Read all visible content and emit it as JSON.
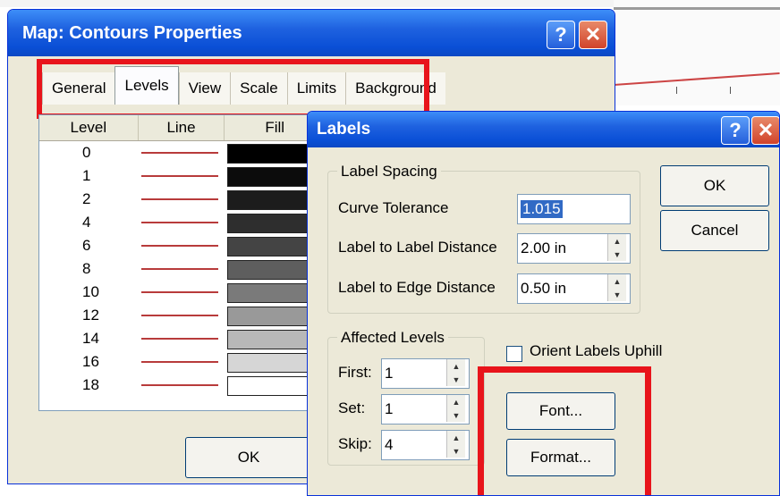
{
  "main_dialog": {
    "title": "Map: Contours Properties",
    "help_glyph": "?",
    "close_glyph": "✕",
    "tabs": [
      "General",
      "Levels",
      "View",
      "Scale",
      "Limits",
      "Background"
    ],
    "active_tab": "Levels",
    "table": {
      "headers": [
        "Level",
        "Line",
        "Fill"
      ],
      "rows": [
        {
          "level": "0",
          "fill": "#000000"
        },
        {
          "level": "1",
          "fill": "#0c0c0c"
        },
        {
          "level": "2",
          "fill": "#1c1c1c"
        },
        {
          "level": "4",
          "fill": "#2e2e2e"
        },
        {
          "level": "6",
          "fill": "#444444"
        },
        {
          "level": "8",
          "fill": "#5e5e5e"
        },
        {
          "level": "10",
          "fill": "#7a7a7a"
        },
        {
          "level": "12",
          "fill": "#999999"
        },
        {
          "level": "14",
          "fill": "#b8b8b8"
        },
        {
          "level": "16",
          "fill": "#d6d6d6"
        },
        {
          "level": "18",
          "fill": "#ffffff"
        }
      ],
      "line_color": "#b83b3b"
    },
    "ok_label": "OK"
  },
  "labels_dialog": {
    "title": "Labels",
    "help_glyph": "?",
    "close_glyph": "✕",
    "label_spacing": {
      "legend": "Label Spacing",
      "curve_tolerance_label": "Curve Tolerance",
      "curve_tolerance_value": "1.015",
      "label_distance_label": "Label to Label Distance",
      "label_distance_value": "2.00 in",
      "edge_distance_label": "Label to Edge Distance",
      "edge_distance_value": "0.50 in"
    },
    "affected_levels": {
      "legend": "Affected Levels",
      "first_label": "First:",
      "first_value": "1",
      "set_label": "Set:",
      "set_value": "1",
      "skip_label": "Skip:",
      "skip_value": "4"
    },
    "orient_uphill_label": "Orient Labels Uphill",
    "orient_uphill_checked": false,
    "ok_label": "OK",
    "cancel_label": "Cancel",
    "font_label": "Font...",
    "format_label": "Format..."
  },
  "highlight_color": "#e8141b"
}
